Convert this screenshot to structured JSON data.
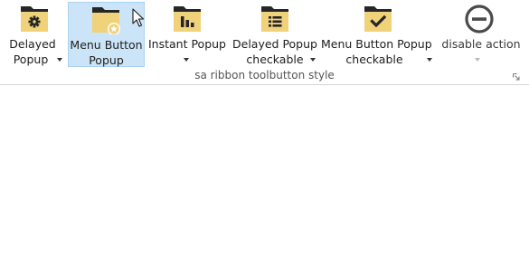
{
  "ribbon": {
    "group_title": "sa ribbon toolbutton style",
    "buttons": [
      {
        "line1": "Delayed",
        "line2": "Popup",
        "icon": "gear-folder-icon"
      },
      {
        "line1": "Menu Button",
        "line2": "Popup",
        "icon": "star-folder-icon"
      },
      {
        "line1": "Instant Popup",
        "line2": "",
        "icon": "chart-folder-icon"
      },
      {
        "line1": "Delayed Popup",
        "line2": "checkable",
        "icon": "list-folder-icon"
      },
      {
        "line1": "Menu Button Popup",
        "line2": "checkable",
        "icon": "check-folder-icon"
      },
      {
        "line1": "disable action",
        "line2": "",
        "icon": "minus-circle-icon"
      }
    ]
  },
  "colors": {
    "folder": "#f0d27a",
    "folder_dark": "#262626",
    "hover_bg": "#cce4f7",
    "hover_border": "#a8d2f2"
  }
}
